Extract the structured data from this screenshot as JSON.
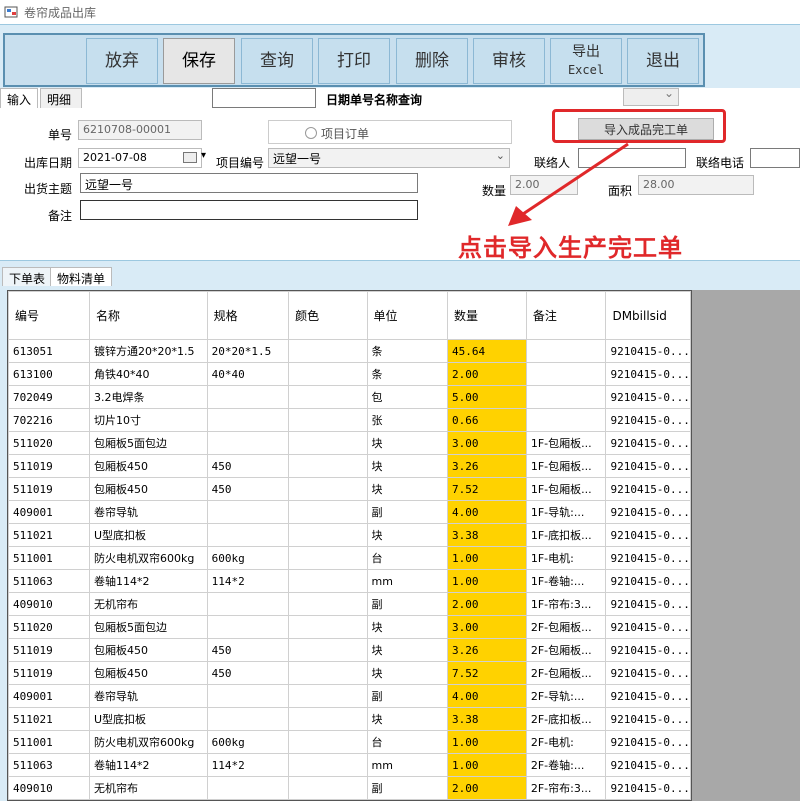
{
  "window": {
    "title": "卷帘成品出库"
  },
  "toolbar": {
    "buttons": [
      "放弃",
      "保存",
      "查询",
      "打印",
      "删除",
      "审核",
      "导出",
      "退出"
    ],
    "export_line1": "导出",
    "export_line2": "Excel"
  },
  "top_tabs": [
    "输入",
    "明细"
  ],
  "search": {
    "label": "日期单号名称查询",
    "value": ""
  },
  "form": {
    "order_no_label": "单号",
    "order_no": "6210708-00001",
    "project_order_label": "项目订单",
    "import_button": "导入成品完工单",
    "date_label": "出库日期",
    "date": "2021-07-08",
    "project_code_label": "项目编号",
    "project_code": "远望一号",
    "contact_label": "联络人",
    "contact": "",
    "phone_label": "联络电话",
    "phone": "",
    "subject_label": "出货主题",
    "subject": "远望一号",
    "qty_label": "数量",
    "qty": "2.00",
    "area_label": "面积",
    "area": "28.00",
    "remark_label": "备注",
    "remark": ""
  },
  "annotation": {
    "text": "点击导入生产完工单",
    "color": "#e0282a"
  },
  "bottom_tabs": [
    "下单表",
    "物料清单"
  ],
  "table": {
    "columns": [
      "编号",
      "名称",
      "规格",
      "颜色",
      "单位",
      "数量",
      "备注",
      "DMbillsid"
    ],
    "rows": [
      [
        "613051",
        "镀锌方通20*20*1.5",
        "20*20*1.5",
        "",
        "条",
        "45.64",
        "",
        "9210415-0..."
      ],
      [
        "613100",
        "角铁40*40",
        "40*40",
        "",
        "条",
        "2.00",
        "",
        "9210415-0..."
      ],
      [
        "702049",
        "3.2电焊条",
        "",
        "",
        "包",
        "5.00",
        "",
        "9210415-0..."
      ],
      [
        "702216",
        "切片10寸",
        "",
        "",
        "张",
        "0.66",
        "",
        "9210415-0..."
      ],
      [
        "511020",
        "包厢板5面包边",
        "",
        "",
        "块",
        "3.00",
        "1F-包厢板...",
        "9210415-0..."
      ],
      [
        "511019",
        "包厢板450",
        "450",
        "",
        "块",
        "3.26",
        "1F-包厢板...",
        "9210415-0..."
      ],
      [
        "511019",
        "包厢板450",
        "450",
        "",
        "块",
        "7.52",
        "1F-包厢板...",
        "9210415-0..."
      ],
      [
        "409001",
        "卷帘导轨",
        "",
        "",
        "副",
        "4.00",
        "1F-导轨:...",
        "9210415-0..."
      ],
      [
        "511021",
        "U型底扣板",
        "",
        "",
        "块",
        "3.38",
        "1F-底扣板...",
        "9210415-0..."
      ],
      [
        "511001",
        "防火电机双帘600kg",
        "600kg",
        "",
        "台",
        "1.00",
        "1F-电机:",
        "9210415-0..."
      ],
      [
        "511063",
        "卷轴114*2",
        "114*2",
        "",
        "mm",
        "1.00",
        "1F-卷轴:...",
        "9210415-0..."
      ],
      [
        "409010",
        "无机帘布",
        "",
        "",
        "副",
        "2.00",
        "1F-帘布:3...",
        "9210415-0..."
      ],
      [
        "511020",
        "包厢板5面包边",
        "",
        "",
        "块",
        "3.00",
        "2F-包厢板...",
        "9210415-0..."
      ],
      [
        "511019",
        "包厢板450",
        "450",
        "",
        "块",
        "3.26",
        "2F-包厢板...",
        "9210415-0..."
      ],
      [
        "511019",
        "包厢板450",
        "450",
        "",
        "块",
        "7.52",
        "2F-包厢板...",
        "9210415-0..."
      ],
      [
        "409001",
        "卷帘导轨",
        "",
        "",
        "副",
        "4.00",
        "2F-导轨:...",
        "9210415-0..."
      ],
      [
        "511021",
        "U型底扣板",
        "",
        "",
        "块",
        "3.38",
        "2F-底扣板...",
        "9210415-0..."
      ],
      [
        "511001",
        "防火电机双帘600kg",
        "600kg",
        "",
        "台",
        "1.00",
        "2F-电机:",
        "9210415-0..."
      ],
      [
        "511063",
        "卷轴114*2",
        "114*2",
        "",
        "mm",
        "1.00",
        "2F-卷轴:...",
        "9210415-0..."
      ],
      [
        "409010",
        "无机帘布",
        "",
        "",
        "副",
        "2.00",
        "2F-帘布:3...",
        "9210415-0..."
      ]
    ]
  }
}
